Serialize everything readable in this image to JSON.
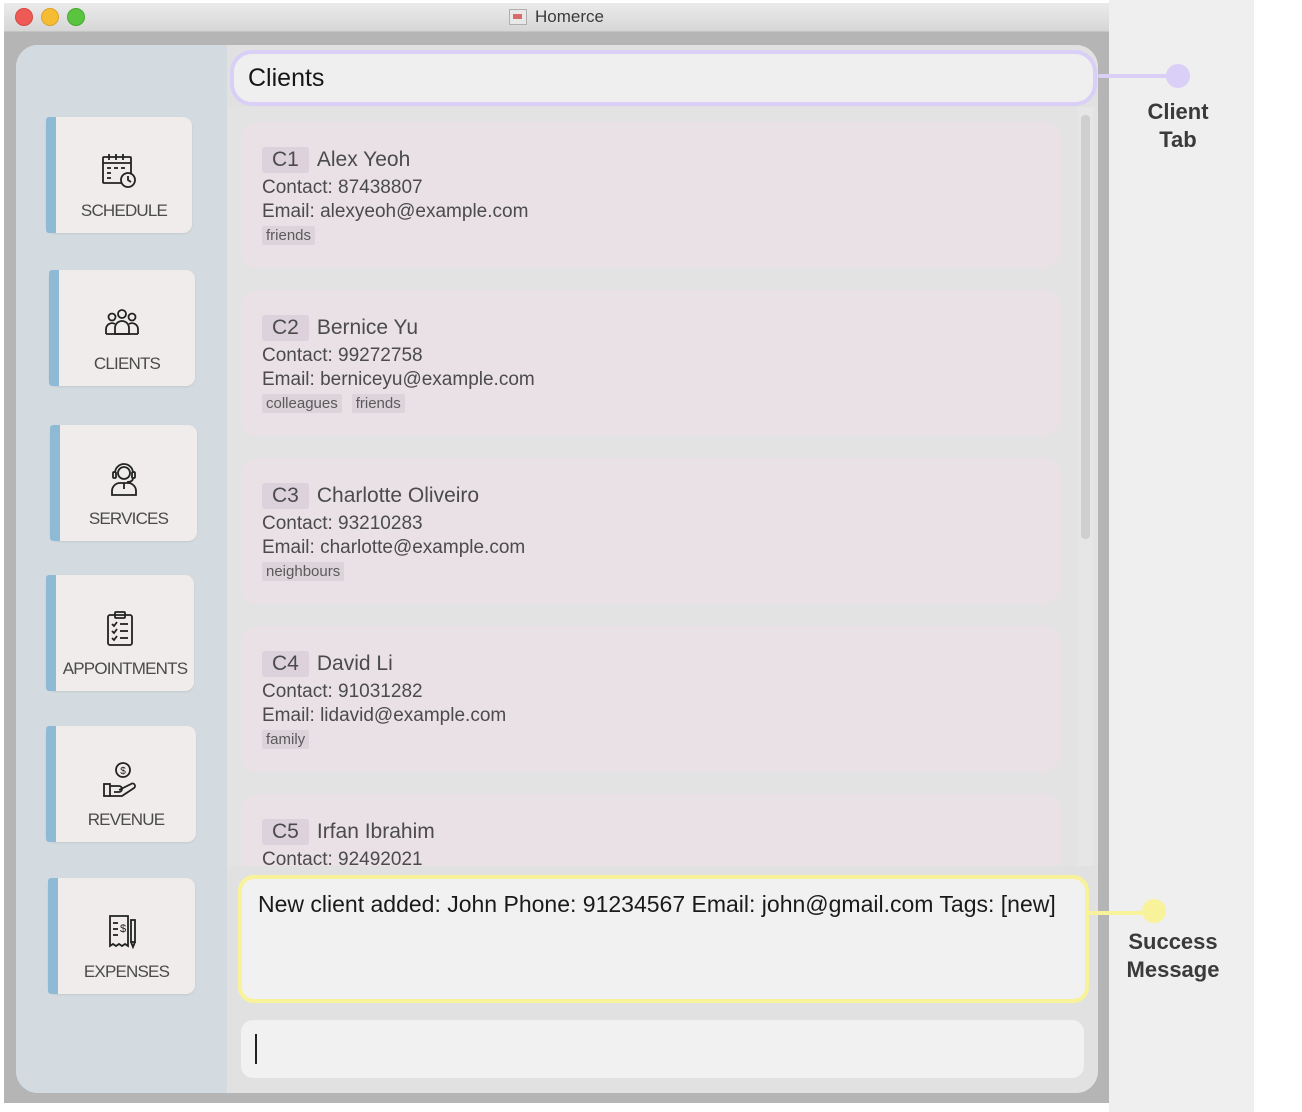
{
  "window": {
    "title": "Homerce"
  },
  "sidebar": {
    "items": [
      {
        "label": "SCHEDULE",
        "icon": "calendar-clock-icon"
      },
      {
        "label": "CLIENTS",
        "icon": "group-icon"
      },
      {
        "label": "SERVICES",
        "icon": "headset-person-icon"
      },
      {
        "label": "APPOINTMENTS",
        "icon": "clipboard-checklist-icon"
      },
      {
        "label": "REVENUE",
        "icon": "hand-dollar-icon"
      },
      {
        "label": "EXPENSES",
        "icon": "receipt-dollar-icon"
      }
    ]
  },
  "main": {
    "tab_title": "Clients",
    "clients": [
      {
        "id": "C1",
        "name": "Alex Yeoh",
        "contact": "Contact: 87438807",
        "email": "Email: alexyeoh@example.com",
        "tags": [
          "friends"
        ]
      },
      {
        "id": "C2",
        "name": "Bernice Yu",
        "contact": "Contact: 99272758",
        "email": "Email: berniceyu@example.com",
        "tags": [
          "colleagues",
          "friends"
        ]
      },
      {
        "id": "C3",
        "name": "Charlotte Oliveiro",
        "contact": "Contact: 93210283",
        "email": "Email: charlotte@example.com",
        "tags": [
          "neighbours"
        ]
      },
      {
        "id": "C4",
        "name": "David Li",
        "contact": "Contact: 91031282",
        "email": "Email: lidavid@example.com",
        "tags": [
          "family"
        ]
      },
      {
        "id": "C5",
        "name": "Irfan Ibrahim",
        "contact": "Contact: 92492021",
        "email": "",
        "tags": []
      }
    ],
    "result_message": "New client added: John Phone: 91234567 Email: john@gmail.com Tags: [new]",
    "command_input_value": ""
  },
  "annotations": {
    "client_tab": "Client Tab",
    "success_message": "Success Message"
  },
  "colors": {
    "tab_highlight": "#d9cff7",
    "success_highlight": "#f8f39a",
    "nav_accent": "#8fbad6",
    "card_bg": "#e9e1e6"
  }
}
